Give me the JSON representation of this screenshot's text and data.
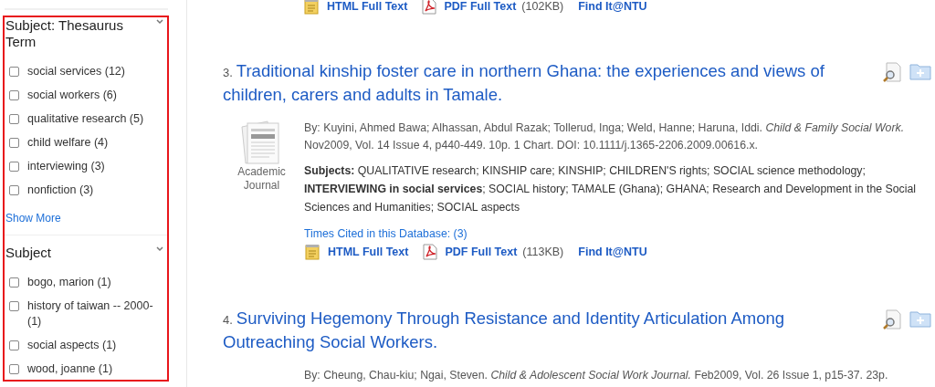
{
  "facets": [
    {
      "title": "Subject: Thesaurus Term",
      "items": [
        {
          "label": "social services (12)",
          "checked": false
        },
        {
          "label": "social workers (6)",
          "checked": false
        },
        {
          "label": "qualitative research (5)",
          "checked": false
        },
        {
          "label": "child welfare (4)",
          "checked": false
        },
        {
          "label": "interviewing (3)",
          "checked": false
        },
        {
          "label": "nonfiction (3)",
          "checked": false
        }
      ],
      "show_more": "Show More"
    },
    {
      "title": "Subject",
      "items": [
        {
          "label": "bogo, marion (1)",
          "checked": false
        },
        {
          "label": "history of taiwan -- 2000- (1)",
          "checked": false
        },
        {
          "label": "social aspects (1)",
          "checked": false
        },
        {
          "label": "wood, joanne (1)",
          "checked": false
        }
      ]
    }
  ],
  "previous_links": [
    {
      "kind": "html",
      "label": "HTML Full Text"
    },
    {
      "kind": "pdf",
      "label": "PDF Full Text",
      "size": "(102KB)"
    },
    {
      "kind": "find",
      "label": "Find It@NTU"
    }
  ],
  "results": [
    {
      "number": "3.",
      "title": "Traditional kinship foster care in northern Ghana: the experiences and views of children, carers and adults in Tamale.",
      "type_label": "Academic Journal",
      "byline": "By: Kuyini, Ahmed Bawa; Alhassan, Abdul Razak; Tollerud, Inga; Weld, Hanne; Haruna, Iddi. *Child & Family Social Work.* Nov2009, Vol. 14 Issue 4, p440-449. 10p. 1 Chart. DOI: 10.1111/j.1365-2206.2009.00616.x.",
      "subjects": "**Subjects:** QUALITATIVE research; KINSHIP care; KINSHIP; CHILDREN'S rights; SOCIAL science methodology; **INTERVIEWING in social services**; SOCIAL history; TAMALE (Ghana); GHANA; Research and Development in the Social Sciences and Humanities; SOCIAL aspects",
      "times_cited": "Times Cited in this Database: (3)",
      "links": [
        {
          "kind": "html",
          "label": "HTML Full Text"
        },
        {
          "kind": "pdf",
          "label": "PDF Full Text",
          "size": "(113KB)"
        },
        {
          "kind": "find",
          "label": "Find It@NTU"
        }
      ]
    },
    {
      "number": "4.",
      "title": "Surviving Hegemony Through Resistance and Identity Articulation Among Outreaching Social Workers.",
      "byline": "By: Cheung, Chau-kiu; Ngai, Steven. *Child & Adolescent Social Work Journal.* Feb2009, Vol. 26 Issue 1, p15-37. 23p."
    }
  ]
}
